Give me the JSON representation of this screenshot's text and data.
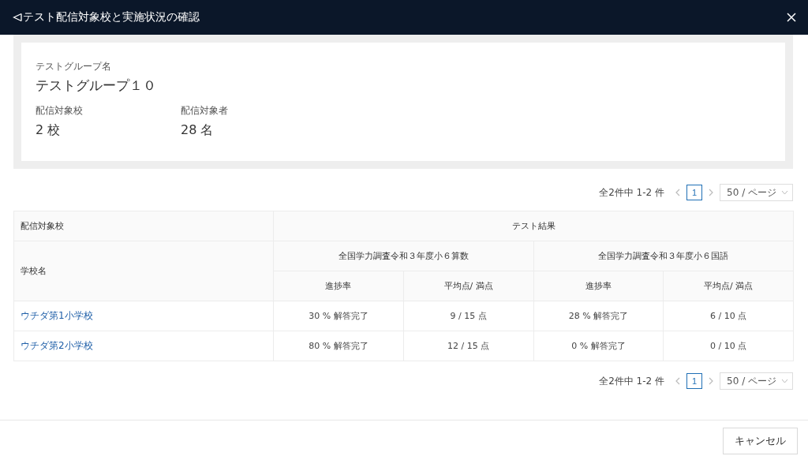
{
  "dialog": {
    "title": "テスト配信対象校と実施状況の確認"
  },
  "summary": {
    "group_label": "テストグループ名",
    "group_name": "テストグループ１０",
    "stats": [
      {
        "label": "配信対象校",
        "value": "2 校"
      },
      {
        "label": "配信対象者",
        "value": "28 名"
      }
    ]
  },
  "pagination_top": {
    "total": "全2件中 1-2 件",
    "pages": [
      {
        "label": "1",
        "selected": true
      }
    ],
    "page_size": "50 / ページ"
  },
  "table": {
    "group_header": "配信対象校",
    "results_header": "テスト結果",
    "school_column": "学校名",
    "tests": [
      {
        "name": "全国学力調査令和３年度小６算数",
        "columns": [
          "進捗率",
          "平均点/ 満点"
        ]
      },
      {
        "name": "全国学力調査令和３年度小６国語",
        "columns": [
          "進捗率",
          "平均点/ 満点"
        ]
      }
    ],
    "rows": [
      {
        "school": "ウチダ第1小学校",
        "cells": [
          "30 % 解答完了",
          "9 / 15 点",
          "28 % 解答完了",
          "6 / 10 点"
        ]
      },
      {
        "school": "ウチダ第2小学校",
        "cells": [
          "80 % 解答完了",
          "12 / 15 点",
          "0 % 解答完了",
          "0 / 10 点"
        ]
      }
    ]
  },
  "pagination_bottom": {
    "total": "全2件中 1-2 件",
    "pages": [
      {
        "label": "1",
        "selected": true
      }
    ],
    "page_size": "50 / ページ"
  },
  "footer": {
    "buttons": [
      "キャンセル"
    ]
  }
}
